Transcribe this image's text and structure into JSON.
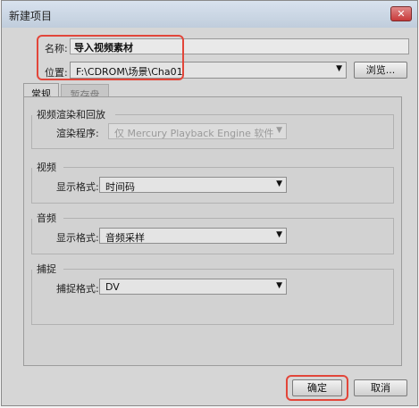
{
  "window": {
    "title": "新建项目",
    "close_label": "✕"
  },
  "name_row": {
    "label": "名称:",
    "value": "导入视频素材"
  },
  "location_row": {
    "label": "位置:",
    "value": "F:\\CDROM\\场景\\Cha01",
    "browse_label": "浏览..."
  },
  "tabs": [
    {
      "label": "常规",
      "active": true
    },
    {
      "label": "暂存盘",
      "active": false
    }
  ],
  "groups": {
    "render": {
      "title": "视频渲染和回放",
      "field_label": "渲染程序:",
      "field_value": "仅 Mercury Playback Engine 软件"
    },
    "video": {
      "title": "视频",
      "field_label": "显示格式:",
      "field_value": "时间码"
    },
    "audio": {
      "title": "音频",
      "field_label": "显示格式:",
      "field_value": "音频采样"
    },
    "capture": {
      "title": "捕捉",
      "field_label": "捕捉格式:",
      "field_value": "DV"
    }
  },
  "buttons": {
    "ok_label": "确定",
    "cancel_label": "取消"
  },
  "colors": {
    "highlight": "#e2463a",
    "dialog_bg": "#d6d6d6"
  },
  "icons": {
    "dropdown": "chevron-down-icon",
    "close": "close-icon"
  }
}
